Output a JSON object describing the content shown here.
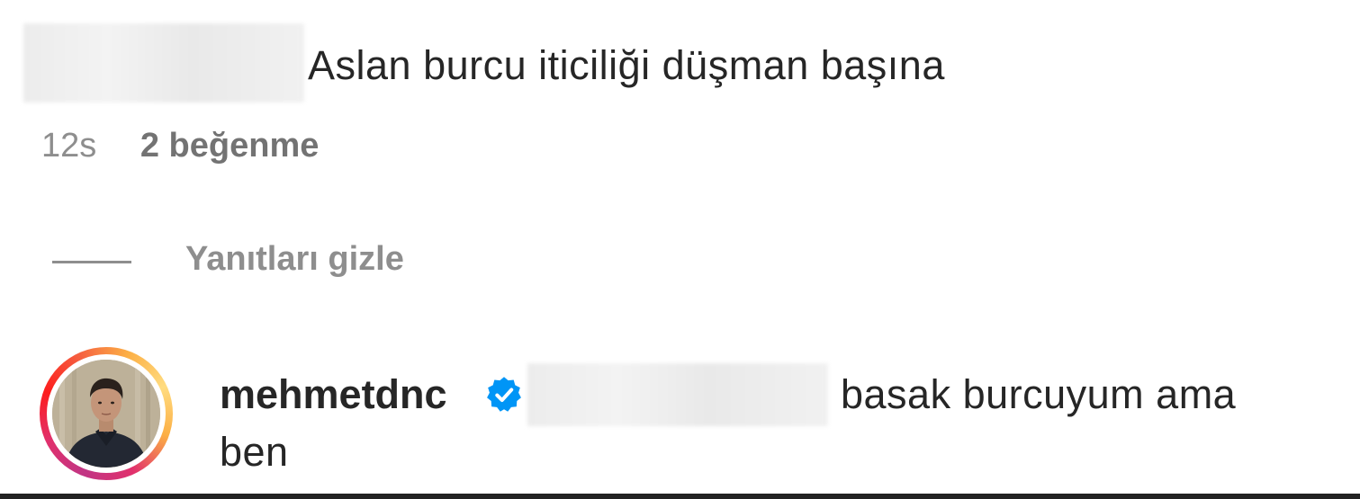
{
  "first_comment": {
    "text": "Aslan burcu iticiliği düşman başına",
    "time": "12s",
    "likes": "2 beğenme"
  },
  "replies_toggle": {
    "label": "Yanıtları gizle"
  },
  "reply_comment": {
    "username": "mehmetdnc",
    "verified_icon": "verified-badge-icon",
    "text_line_1": "basak burcuyum ama",
    "text_line_2": "ben"
  },
  "colors": {
    "text_primary": "#262626",
    "text_secondary": "#8e8e8e",
    "verified_blue": "#0095f6",
    "story_ring_start": "#c13584",
    "story_ring_end": "#fcaf45"
  }
}
